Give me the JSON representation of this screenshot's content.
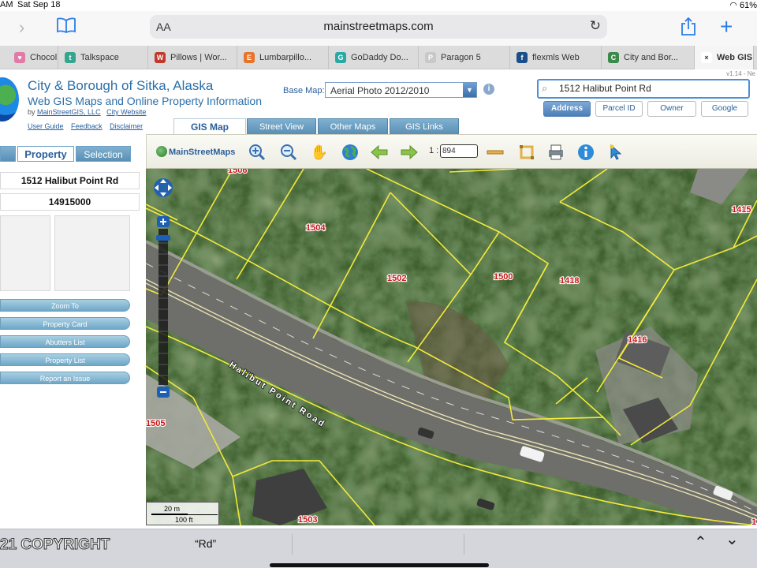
{
  "status": {
    "time": "AM",
    "date": "Sat Sep 18",
    "battery": "61%"
  },
  "browser": {
    "text_size_label": "AA",
    "url": "mainstreetmaps.com",
    "tabs": [
      {
        "label": "Chocol",
        "color": "#e27aa8",
        "glyph": "♥"
      },
      {
        "label": "Talkspace",
        "color": "#35a58e",
        "glyph": "t"
      },
      {
        "label": "Pillows | Wor...",
        "color": "#c0392b",
        "glyph": "W"
      },
      {
        "label": "Lumbarpillo...",
        "color": "#e8732a",
        "glyph": "E"
      },
      {
        "label": "GoDaddy Do...",
        "color": "#2aa9a4",
        "glyph": "G"
      },
      {
        "label": "Paragon 5",
        "color": "#c8c8c8",
        "glyph": "P"
      },
      {
        "label": "flexmls Web",
        "color": "#1a4e8a",
        "glyph": "f"
      },
      {
        "label": "City and Bor...",
        "color": "#3b8a4a",
        "glyph": "C"
      },
      {
        "label": "Web GIS",
        "color": "#ffffff",
        "glyph": "×"
      }
    ]
  },
  "app": {
    "title": "City & Borough of Sitka, Alaska",
    "subtitle": "Web GIS Maps and Online Property Information",
    "by_prefix": "by",
    "by_company": "MainStreetGIS, LLC",
    "city_website": "City Website",
    "links": [
      "User Guide",
      "Feedback",
      "Disclaimer"
    ],
    "version": "v1.14 - Ne",
    "base_map_label": "Base Map:",
    "base_map_value": "Aerial Photo 2012/2010",
    "search_value": "1512 Halibut Point Rd",
    "search_buttons": [
      "Address",
      "Parcel ID",
      "Owner",
      "Google"
    ],
    "map_tabs": [
      "GIS Map",
      "Street View",
      "Other Maps",
      "GIS Links"
    ]
  },
  "left_panel": {
    "tabs": [
      "",
      "Property",
      "Selection"
    ],
    "address": "1512 Halibut Point Rd",
    "parcel_id": "14915000",
    "actions": [
      "Zoom To",
      "Property Card",
      "Abutters List",
      "Property List",
      "Report an Issue"
    ]
  },
  "map_toolbar": {
    "logo": "MainStreetMaps",
    "scale_prefix": "1 :",
    "scale_value": "894"
  },
  "map": {
    "road_label": "Halibut Point Road",
    "parcels": [
      "1506",
      "1504",
      "1502",
      "1500",
      "1418",
      "1416",
      "1415",
      "1505",
      "1503",
      "1"
    ],
    "scale_m": "20 m",
    "scale_ft": "100 ft",
    "colors": {
      "parcel_line": "#f2ea3a",
      "parcel_label": "#c81414"
    }
  },
  "keyboard_bar": {
    "suggestion": "“Rd”",
    "watermark": "21 COPYRIGHT"
  }
}
